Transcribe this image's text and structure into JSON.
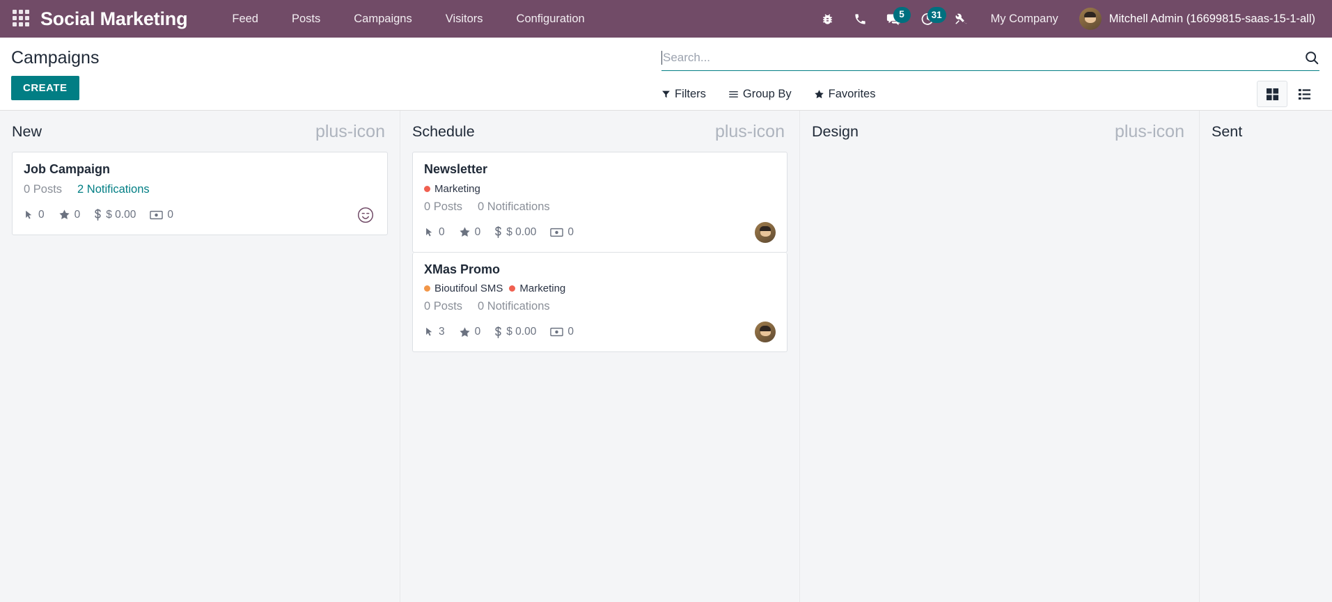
{
  "navbar": {
    "apps_icon": "apps-grid-icon",
    "brand": "Social Marketing",
    "menu": [
      {
        "label": "Feed"
      },
      {
        "label": "Posts"
      },
      {
        "label": "Campaigns"
      },
      {
        "label": "Visitors"
      },
      {
        "label": "Configuration"
      }
    ],
    "tray": [
      {
        "name": "bug-icon",
        "badge": null
      },
      {
        "name": "phone-icon",
        "badge": null
      },
      {
        "name": "messages-icon",
        "badge": "5"
      },
      {
        "name": "activities-clock-icon",
        "badge": "31"
      },
      {
        "name": "tools-icon",
        "badge": null
      }
    ],
    "company": "My Company",
    "user": "Mitchell Admin (16699815-saas-15-1-all)",
    "colors": {
      "background": "#714B67",
      "badge": "#00707F"
    }
  },
  "control_panel": {
    "title": "Campaigns",
    "create_label": "CREATE",
    "search": {
      "placeholder": "Search...",
      "value": "",
      "icon": "search-icon"
    },
    "filters": [
      {
        "label": "Filters",
        "icon": "filter-funnel-icon"
      },
      {
        "label": "Group By",
        "icon": "bars-icon"
      },
      {
        "label": "Favorites",
        "icon": "star-icon"
      }
    ],
    "views": [
      {
        "name": "kanban-view",
        "icon": "kanban-icon",
        "active": true
      },
      {
        "name": "list-view",
        "icon": "list-icon",
        "active": false
      }
    ],
    "accent_color": "#017E84"
  },
  "kanban": {
    "add_icon": "plus-icon",
    "columns": [
      {
        "title": "New",
        "cards": [
          {
            "title": "Job Campaign",
            "tags": [],
            "posts": "0 Posts",
            "notifications": "2 Notifications",
            "notifications_link": true,
            "stats": [
              {
                "icon": "mouse-pointer-icon",
                "value": "0"
              },
              {
                "icon": "star-icon",
                "value": "0"
              },
              {
                "icon": "dollar-sign-icon",
                "value": "$ 0.00"
              },
              {
                "icon": "money-bill-icon",
                "value": "0"
              }
            ],
            "avatar": "smiley-placeholder-avatar"
          }
        ]
      },
      {
        "title": "Schedule",
        "cards": [
          {
            "title": "Newsletter",
            "tags": [
              {
                "label": "Marketing",
                "color": "#F06050"
              }
            ],
            "posts": "0 Posts",
            "notifications": "0 Notifications",
            "notifications_link": false,
            "stats": [
              {
                "icon": "mouse-pointer-icon",
                "value": "0"
              },
              {
                "icon": "star-icon",
                "value": "0"
              },
              {
                "icon": "dollar-sign-icon",
                "value": "$ 0.00"
              },
              {
                "icon": "money-bill-icon",
                "value": "0"
              }
            ],
            "avatar": "user-photo-avatar"
          },
          {
            "title": "XMas Promo",
            "tags": [
              {
                "label": "Bioutifoul SMS",
                "color": "#F29648"
              },
              {
                "label": "Marketing",
                "color": "#F06050"
              }
            ],
            "posts": "0 Posts",
            "notifications": "0 Notifications",
            "notifications_link": false,
            "stats": [
              {
                "icon": "mouse-pointer-icon",
                "value": "3"
              },
              {
                "icon": "star-icon",
                "value": "0"
              },
              {
                "icon": "dollar-sign-icon",
                "value": "$ 0.00"
              },
              {
                "icon": "money-bill-icon",
                "value": "0"
              }
            ],
            "avatar": "user-photo-avatar"
          }
        ]
      },
      {
        "title": "Design",
        "cards": []
      },
      {
        "title": "Sent",
        "cards": []
      }
    ]
  }
}
